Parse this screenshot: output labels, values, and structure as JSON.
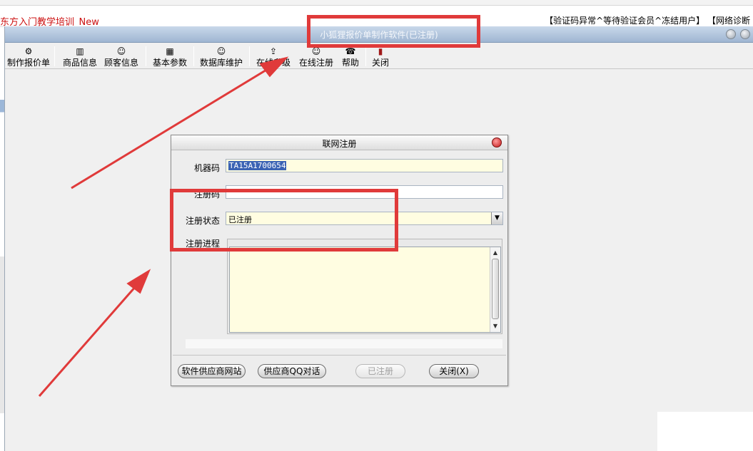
{
  "background_app": {
    "title_fragment": "东方入门教学培训_New",
    "status_text": "【验证码异常^等待验证会员^冻结用户】 【网络诊断"
  },
  "window": {
    "title": "小狐狸报价单制作软件(已注册)"
  },
  "toolbar": {
    "items": [
      {
        "label": "制作报价单",
        "icon": "gear-icon"
      },
      {
        "label": "商品信息",
        "icon": "product-icon"
      },
      {
        "label": "顾客信息",
        "icon": "person-icon"
      },
      {
        "label": "基本参数",
        "icon": "calendar-icon"
      },
      {
        "label": "数据库维护",
        "icon": "person-icon"
      },
      {
        "label": "在线升级",
        "icon": "upgrade-icon"
      },
      {
        "label": "在线注册",
        "icon": "person-icon"
      },
      {
        "label": "帮助",
        "icon": "help-icon"
      },
      {
        "label": "关闭",
        "icon": "exit-icon"
      }
    ]
  },
  "dialog": {
    "title": "联网注册",
    "machine_code_label": "机器码",
    "machine_code_value": "TA15A1700654",
    "reg_code_label": "注册码",
    "reg_code_value": "",
    "status_label": "注册状态",
    "status_value": "已注册",
    "progress_label": "注册进程",
    "buttons": {
      "vendor_site": "软件供应商网站",
      "vendor_qq": "供应商QQ对话",
      "registered": "已注册",
      "close": "关闭(X)"
    }
  },
  "colors": {
    "annotation_red": "#e03a3a",
    "field_yellow": "#fffde1",
    "selection_blue": "#3b63b4"
  }
}
